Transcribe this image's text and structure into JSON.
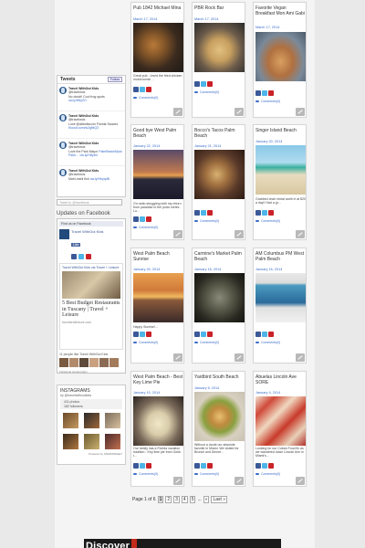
{
  "twitter": {
    "title": "Tweets",
    "follow_label": "Follow",
    "tweets": [
      {
        "name": "Travel WithOut Kids",
        "handle": "@travelwok",
        "text": "No doubt! Cool frog spots ",
        "link": "ow.ly/H8yZO"
      },
      {
        "name": "Travel WithOut Kids",
        "handle": "@travelwok",
        "text": "Love @atlantiscom Florida Sauces ",
        "link": "Kloout.com/w2gNtQ3"
      },
      {
        "name": "Travel WithOut Kids",
        "handle": "@travelwok",
        "text": "Love the Park Mayor ",
        "link": "PalmBeachMyst Palm… ow.ly/H8y4m"
      },
      {
        "name": "Travel WithOut Kids",
        "handle": "@travelwok",
        "text": "Mahi-mahi fish ",
        "link": "ow.ly/HbyqdB"
      }
    ],
    "input_placeholder": "Tweet to @travelwok"
  },
  "facebook": {
    "title": "Updates on Facebook",
    "header": "Find us on Facebook",
    "page_name": "Travel WithOut Kids",
    "like_label": "Like",
    "post_meta": "Travel WithOut Kids via Travel + Leisure",
    "post_text": "5 Best Budget Restaurants in Tuscany | Travel + Leisure",
    "post_source": "travelandleisure.com",
    "likes_text": "11 people like Travel WithOut Kids",
    "footer": "Facebook social plugin"
  },
  "instagram": {
    "title": "INSTAGRAMS",
    "user": "by @travelwithoutkids",
    "photos": "411 photos",
    "followers": "182 followers",
    "footer": "Powered by SNAPWIDGET"
  },
  "posts": [
    {
      "title": "Pub 1842 Michael Mina",
      "date": "March 17, 2014",
      "excerpt": "Great pub - loved the fried chicken mushrooms!…",
      "comments": "Comments(0)"
    },
    {
      "title": "PBR Rock Bar",
      "date": "March 17, 2014",
      "excerpt": "",
      "comments": "Comments(0)"
    },
    {
      "title": "Favorite Vegan Breakfast Mon Ami Gabi",
      "date": "March 17, 2014",
      "excerpt": "",
      "comments": "Comments(0)"
    },
    {
      "title": "Good bye West Palm Beach",
      "date": "January 22, 2014",
      "excerpt": "On radio struggling with my return from paradise to the polar vortex. Lu…",
      "comments": "Comments(0)"
    },
    {
      "title": "Bocco's Tacos Palm Beach",
      "date": "January 21, 2014",
      "excerpt": "",
      "comments": "Comments(0)"
    },
    {
      "title": "Singer Island Beach",
      "date": "January 20, 2014",
      "excerpt": "Grabbed chair rental worth it at $20 a day!! Had a gr…",
      "comments": "Comments(0)"
    },
    {
      "title": "West Palm Beach Sunrise",
      "date": "January 20, 2014",
      "excerpt": "Happy Sunrise!…",
      "comments": "Comments(0)"
    },
    {
      "title": "Carmine's Market Palm Beach",
      "date": "January 16, 2014",
      "excerpt": "",
      "comments": "Comments(0)"
    },
    {
      "title": "AM Columbus PM West Palm Beach",
      "date": "January 16, 2014",
      "excerpt": "",
      "comments": "Comments(0)"
    },
    {
      "title": "West Palm Beach - Best Key Lime Pie",
      "date": "January 10, 2014",
      "excerpt": "Our family has a Florida vacation tradition - Key lime pie from Golla I…",
      "comments": "Comments(0)"
    },
    {
      "title": "Yardbird South Beach",
      "date": "January 6, 2014",
      "excerpt": "Without a doubt our absolute favorite in Miami. We visited for Brunch and Dinner…",
      "comments": "Comments(0)"
    },
    {
      "title": "Abuelas Lincoln Ave SORE",
      "date": "January 4, 2014",
      "excerpt": "Looking for our Cuban Food fix as we wandered down Lincoln Ave in Miami's…",
      "comments": "Comments(0)"
    }
  ],
  "pagination": {
    "label": "Page 1 of 6",
    "pages": [
      "1",
      "2",
      "3",
      "4",
      "5",
      "...",
      "»",
      "Last »"
    ]
  },
  "banner": {
    "text": "Discover"
  }
}
